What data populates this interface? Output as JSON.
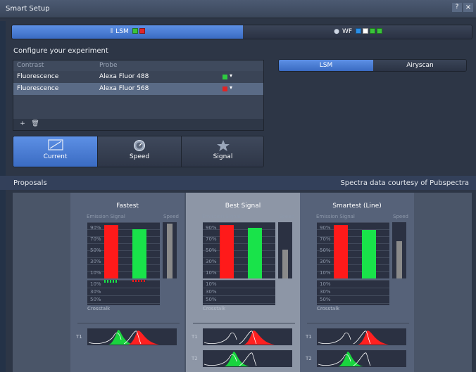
{
  "window": {
    "title": "Smart Setup",
    "help": "?",
    "close": "×"
  },
  "modes": [
    {
      "label": "LSM",
      "swatches": [
        "#39c33a",
        "#e0262a"
      ]
    },
    {
      "label": "WF",
      "swatches": [
        "#2a8fe8",
        "#ffffff",
        "#39c33a",
        "#39c33a"
      ]
    }
  ],
  "configure": {
    "heading": "Configure your experiment",
    "columns": [
      "Contrast",
      "Probe"
    ],
    "rows": [
      {
        "contrast": "Fluorescence",
        "probe": "Alexa Fluor 488",
        "color": "#2ecc40"
      },
      {
        "contrast": "Fluorescence",
        "probe": "Alexa Fluor 568",
        "color": "#e02424"
      }
    ],
    "add": "+",
    "delete": "🗑"
  },
  "detector_tabs": [
    "LSM",
    "Airyscan"
  ],
  "goals": [
    {
      "label": "Current",
      "icon": "current-icon"
    },
    {
      "label": "Speed",
      "icon": "speed-icon"
    },
    {
      "label": "Signal",
      "icon": "star-icon"
    }
  ],
  "proposals": {
    "heading": "Proposals",
    "credit": "Spectra data courtesy of Pubspectra",
    "emission_label": "Emission Signal",
    "speed_label": "Speed",
    "crosstalk_label": "Crosstalk",
    "upper_ticks": [
      "90%",
      "70%",
      "50%",
      "30%",
      "10%"
    ],
    "lower_ticks": [
      "10%",
      "30%",
      "50%"
    ],
    "items": [
      {
        "title": "Fastest",
        "red": 0.98,
        "green": 0.9,
        "speed": 1.0,
        "crosstalk": true,
        "tracks": [
          "T1"
        ]
      },
      {
        "title": "Best Signal",
        "red": 0.98,
        "green": 0.92,
        "speed": 0.52,
        "crosstalk": false,
        "tracks": [
          "T1",
          "T2"
        ]
      },
      {
        "title": "Smartest (Line)",
        "red": 0.98,
        "green": 0.88,
        "speed": 0.68,
        "crosstalk": false,
        "tracks": [
          "T1",
          "T2"
        ]
      }
    ]
  }
}
